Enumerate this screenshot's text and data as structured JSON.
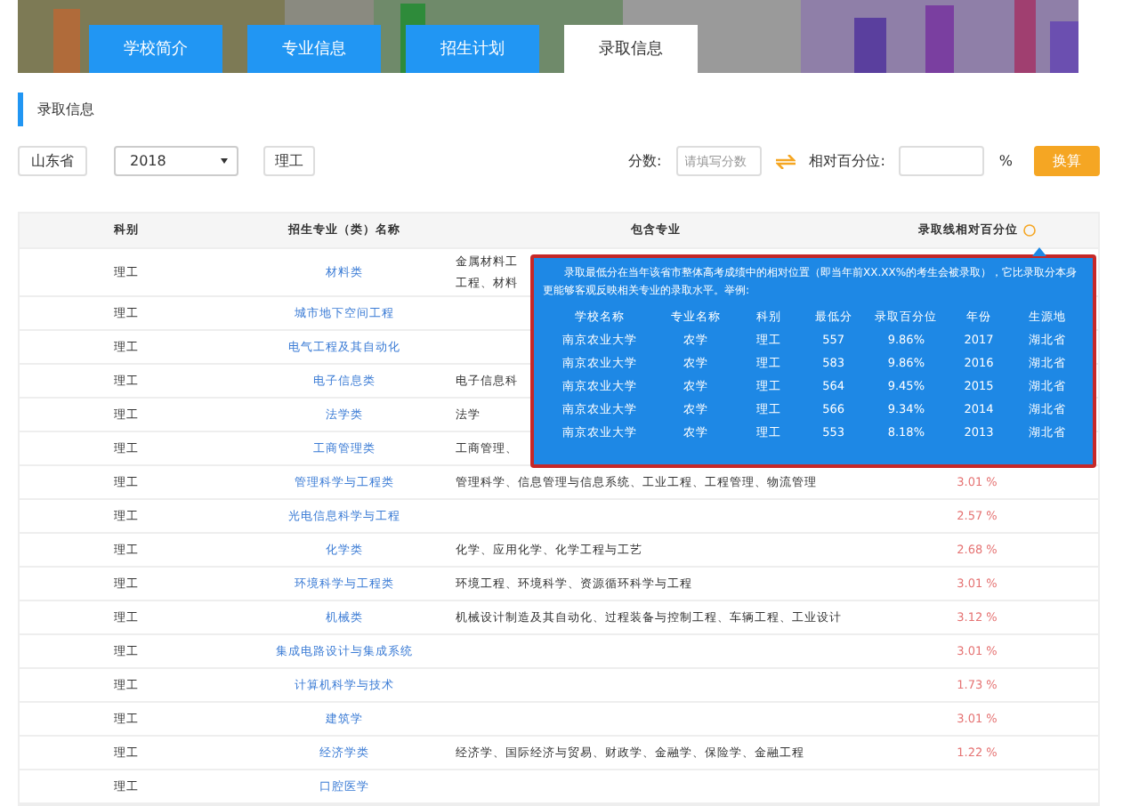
{
  "tabs": [
    {
      "label": "学校简介",
      "selected": false
    },
    {
      "label": "专业信息",
      "selected": false
    },
    {
      "label": "招生计划",
      "selected": false
    },
    {
      "label": "录取信息",
      "selected": true
    }
  ],
  "section_title": "录取信息",
  "filters": {
    "province": "山东省",
    "year": "2018",
    "category": "理工",
    "score_label": "分数:",
    "score_placeholder": "请填写分数",
    "percent_label": "相对百分位:",
    "percent_unit": "%",
    "convert_button": "换算"
  },
  "table": {
    "columns": [
      "科别",
      "招生专业（类）名称",
      "包含专业",
      "录取线相对百分位"
    ],
    "rows": [
      {
        "category": "理工",
        "major": "材料类",
        "content": "金属材料工",
        "content_2": "工程、材料"
      },
      {
        "category": "理工",
        "major": "城市地下空间工程"
      },
      {
        "category": "理工",
        "major": "电气工程及其自动化"
      },
      {
        "category": "理工",
        "major": "电子信息类",
        "content": "电子信息科"
      },
      {
        "category": "理工",
        "major": "法学类",
        "content": "法学"
      },
      {
        "category": "理工",
        "major": "工商管理类",
        "content": "工商管理、"
      },
      {
        "category": "理工",
        "major": "管理科学与工程类",
        "content": "管理科学、信息管理与信息系统、工业工程、工程管理、物流管理",
        "percent": "3.01 %"
      },
      {
        "category": "理工",
        "major": "光电信息科学与工程",
        "percent": "2.57 %"
      },
      {
        "category": "理工",
        "major": "化学类",
        "content": "化学、应用化学、化学工程与工艺",
        "percent": "2.68 %"
      },
      {
        "category": "理工",
        "major": "环境科学与工程类",
        "content": "环境工程、环境科学、资源循环科学与工程",
        "percent": "3.01 %"
      },
      {
        "category": "理工",
        "major": "机械类",
        "content": "机械设计制造及其自动化、过程装备与控制工程、车辆工程、工业设计",
        "percent": "3.12 %"
      },
      {
        "category": "理工",
        "major": "集成电路设计与集成系统",
        "percent": "3.01 %"
      },
      {
        "category": "理工",
        "major": "计算机科学与技术",
        "percent": "1.73 %"
      },
      {
        "category": "理工",
        "major": "建筑学",
        "percent": "3.01 %"
      },
      {
        "category": "理工",
        "major": "经济学类",
        "content": "经济学、国际经济与贸易、财政学、金融学、保险学、金融工程",
        "percent": "1.22 %"
      },
      {
        "category": "理工",
        "major": "口腔医学"
      }
    ]
  },
  "tooltip": {
    "text": "录取最低分在当年该省市整体高考成绩中的相对位置（即当年前XX.XX%的考生会被录取），它比录取分本身更能够客观反映相关专业的录取水平。举例:",
    "columns": [
      "学校名称",
      "专业名称",
      "科别",
      "最低分",
      "录取百分位",
      "年份",
      "生源地"
    ],
    "rows": [
      [
        "南京农业大学",
        "农学",
        "理工",
        "557",
        "9.86%",
        "2017",
        "湖北省"
      ],
      [
        "南京农业大学",
        "农学",
        "理工",
        "583",
        "9.86%",
        "2016",
        "湖北省"
      ],
      [
        "南京农业大学",
        "农学",
        "理工",
        "564",
        "9.45%",
        "2015",
        "湖北省"
      ],
      [
        "南京农业大学",
        "农学",
        "理工",
        "566",
        "9.34%",
        "2014",
        "湖北省"
      ],
      [
        "南京农业大学",
        "农学",
        "理工",
        "553",
        "8.18%",
        "2013",
        "湖北省"
      ]
    ]
  }
}
